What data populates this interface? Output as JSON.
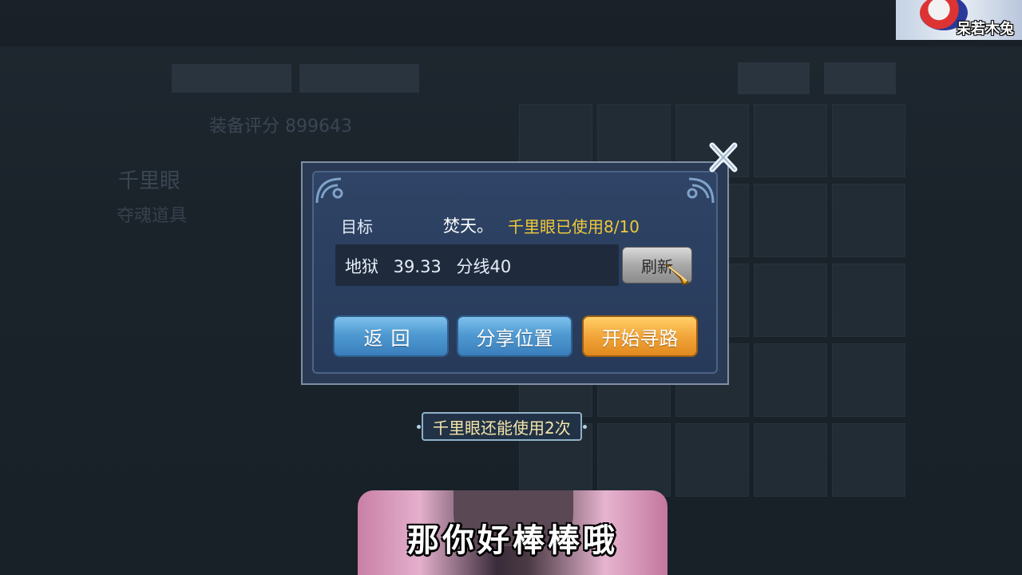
{
  "dialog": {
    "target_label": "目标",
    "target_name": "焚天。",
    "usage_text": "千里眼已使用8/10",
    "location_text": "地狱 39.33 分线40",
    "refresh_label": "刷新",
    "buttons": {
      "back": "返回",
      "share": "分享位置",
      "start": "开始寻路"
    }
  },
  "remaining_text": "千里眼还能使用2次",
  "background": {
    "score": "装备评分 899643",
    "item_title": "千里眼",
    "item_subtitle": "夺魂道具"
  },
  "overlay": {
    "streamer_name": "呆若木兔",
    "sticker_text": "那你好棒棒哦"
  },
  "colors": {
    "usage": "#f0c93a",
    "blue_button": "#4f9ad2",
    "orange_button": "#f2a53a"
  }
}
